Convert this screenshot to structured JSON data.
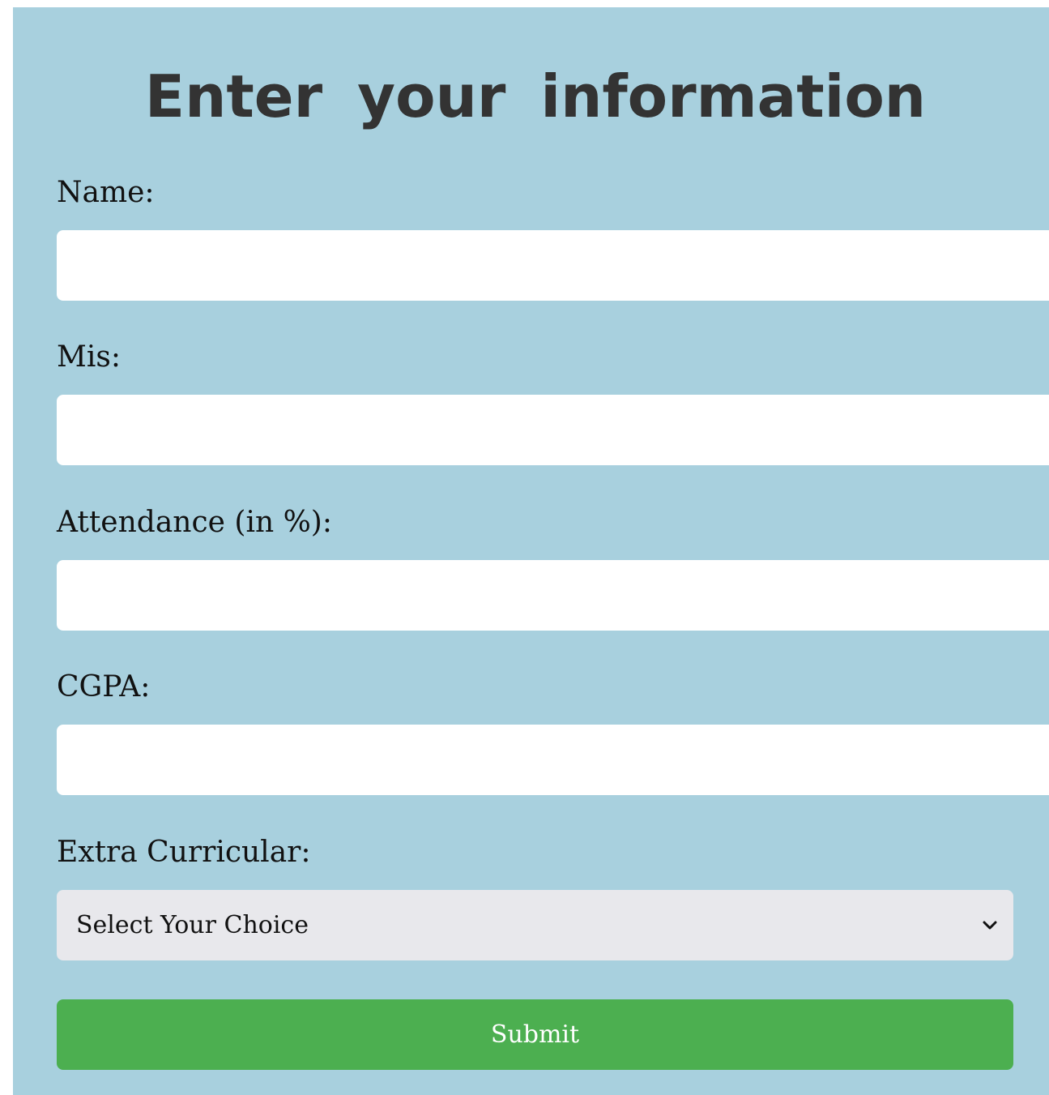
{
  "page": {
    "title": "Enter your information"
  },
  "form": {
    "fields": [
      {
        "label": "Name:",
        "value": "",
        "placeholder": ""
      },
      {
        "label": "Mis:",
        "value": "",
        "placeholder": ""
      },
      {
        "label": "Attendance (in %):",
        "value": "",
        "placeholder": ""
      },
      {
        "label": "CGPA:",
        "value": "",
        "placeholder": ""
      }
    ],
    "extra_curricular": {
      "label": "Extra Curricular:",
      "selected": "Select Your Choice",
      "icon": "chevron-down-icon"
    },
    "submit_label": "Submit"
  },
  "colors": {
    "panel_background": "#a8d0de",
    "input_background": "#ffffff",
    "select_background": "#e8e8ec",
    "submit_button": "#4caf50",
    "title_text": "#333333"
  }
}
